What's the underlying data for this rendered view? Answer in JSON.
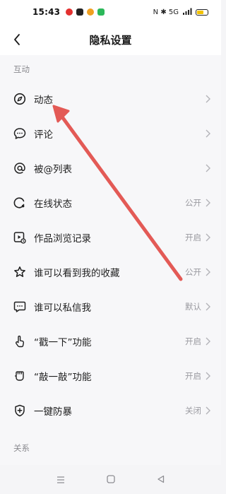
{
  "status_bar": {
    "time": "15:43",
    "right_text": "N ✱ 5G"
  },
  "header": {
    "title": "隐私设置"
  },
  "sections": [
    {
      "label": "互动",
      "items": [
        {
          "label": "动态",
          "value": "",
          "icon": "compass-icon"
        },
        {
          "label": "评论",
          "value": "",
          "icon": "comment-icon"
        },
        {
          "label": "被@列表",
          "value": "",
          "icon": "at-icon"
        },
        {
          "label": "在线状态",
          "value": "公开",
          "icon": "online-status-icon"
        },
        {
          "label": "作品浏览记录",
          "value": "开启",
          "icon": "view-history-icon"
        },
        {
          "label": "谁可以看到我的收藏",
          "value": "公开",
          "icon": "star-icon"
        },
        {
          "label": "谁可以私信我",
          "value": "默认",
          "icon": "message-icon"
        },
        {
          "label": "“戳一下”功能",
          "value": "开启",
          "icon": "poke-icon"
        },
        {
          "label": "“敲一敲”功能",
          "value": "开启",
          "icon": "knock-icon"
        },
        {
          "label": "一键防暴",
          "value": "关闭",
          "icon": "shield-plus-icon"
        }
      ]
    },
    {
      "label": "关系",
      "items": []
    }
  ],
  "colors": {
    "annotation_arrow": "#e35a56",
    "battery": "#f2c200"
  }
}
